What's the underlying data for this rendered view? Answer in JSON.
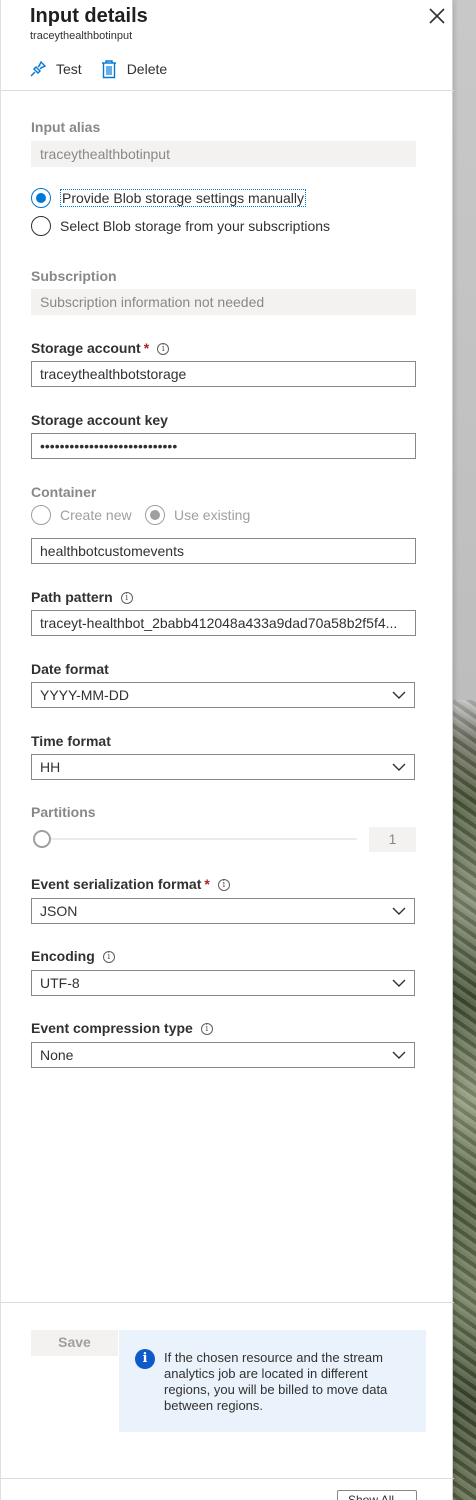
{
  "header": {
    "title": "Input details",
    "subtitle": "traceythealthbotinput"
  },
  "toolbar": {
    "test_label": "Test",
    "delete_label": "Delete"
  },
  "form": {
    "input_alias": {
      "label": "Input alias",
      "value": "traceythealthbotinput"
    },
    "blob_options": {
      "manual": "Provide Blob storage settings manually",
      "subscriptions": "Select Blob storage from your subscriptions",
      "selected": "manual"
    },
    "subscription": {
      "label": "Subscription",
      "value": "Subscription information not needed"
    },
    "storage_account": {
      "label": "Storage account",
      "required": "*",
      "value": "traceythealthbotstorage"
    },
    "storage_key": {
      "label": "Storage account key",
      "value": "••••••••••••••••••••••••••••"
    },
    "container": {
      "label": "Container",
      "create_new": "Create new",
      "use_existing": "Use existing",
      "value": "healthbotcustomevents"
    },
    "path_pattern": {
      "label": "Path pattern",
      "value": "traceyt-healthbot_2babb412048a433a9dad70a58b2f5f4..."
    },
    "date_format": {
      "label": "Date format",
      "value": "YYYY-MM-DD"
    },
    "time_format": {
      "label": "Time format",
      "value": "HH"
    },
    "partitions": {
      "label": "Partitions",
      "value": "1"
    },
    "serialization": {
      "label": "Event serialization format",
      "required": "*",
      "value": "JSON"
    },
    "encoding": {
      "label": "Encoding",
      "value": "UTF-8"
    },
    "compression": {
      "label": "Event compression type",
      "value": "None"
    }
  },
  "footer": {
    "save_label": "Save",
    "notice": "If the chosen resource and the stream analytics job are located in different regions, you will be billed to move data between regions.",
    "bottom_button": "Show All"
  },
  "colors": {
    "accent": "#0078d4",
    "required": "#a4262c",
    "notice_bg": "#eaf2fb"
  },
  "icons": [
    "close-icon",
    "plug-icon",
    "trash-icon",
    "info-icon",
    "chevron-down-icon"
  ]
}
